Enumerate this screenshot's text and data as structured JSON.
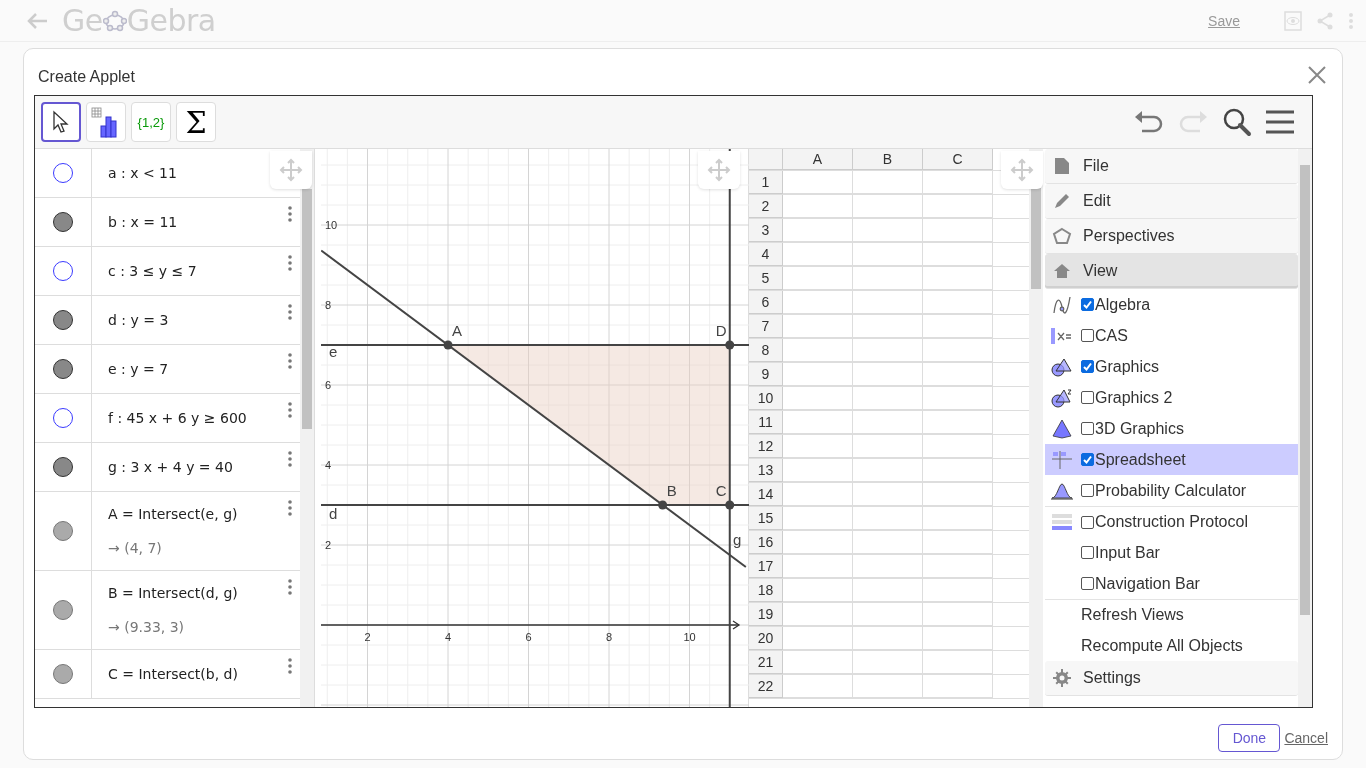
{
  "header": {
    "logo_start": "Ge",
    "logo_end": "Gebra",
    "save": "Save"
  },
  "dialog": {
    "title": "Create Applet",
    "done": "Done",
    "cancel": "Cancel"
  },
  "toolbar": {
    "tools": [
      {
        "kind": "pointer",
        "selected": true
      },
      {
        "kind": "chart",
        "selected": false
      },
      {
        "kind": "text",
        "label": "{1,2}",
        "selected": false
      },
      {
        "kind": "text",
        "label": "Σ",
        "selected": false
      }
    ]
  },
  "algebra": {
    "rows": [
      {
        "kind": "region",
        "definition": "a : x < 11"
      },
      {
        "kind": "line",
        "definition": "b : x = 11"
      },
      {
        "kind": "region",
        "definition": "c : 3 ≤ y ≤ 7"
      },
      {
        "kind": "line",
        "definition": "d : y = 3"
      },
      {
        "kind": "line",
        "definition": "e : y = 7"
      },
      {
        "kind": "region",
        "definition": "f : 45 x + 6 y ≥ 600"
      },
      {
        "kind": "line",
        "definition": "g : 3 x + 4 y = 40"
      },
      {
        "kind": "point",
        "definition": "A = Intersect(e, g)",
        "output": "→  (4, 7)"
      },
      {
        "kind": "point",
        "definition": "B = Intersect(d, g)",
        "output": "→  (9.33, 3)"
      },
      {
        "kind": "point",
        "definition": "C = Intersect(b, d)"
      }
    ]
  },
  "graphics": {
    "x_ticks": [
      "2",
      "4",
      "6",
      "8",
      "10"
    ],
    "y_ticks": [
      "10",
      "8",
      "6",
      "4",
      "2"
    ],
    "point_labels": [
      "A",
      "D",
      "B",
      "C"
    ],
    "line_labels": [
      "e",
      "d",
      "g"
    ]
  },
  "spreadsheet": {
    "columns": [
      "A",
      "B",
      "C"
    ],
    "rows": [
      "1",
      "2",
      "3",
      "4",
      "5",
      "6",
      "7",
      "8",
      "9",
      "10",
      "11",
      "12",
      "13",
      "14",
      "15",
      "16",
      "17",
      "18",
      "19",
      "20",
      "21",
      "22"
    ]
  },
  "menu": {
    "items": [
      {
        "kind": "section",
        "label": "File"
      },
      {
        "kind": "section",
        "label": "Edit"
      },
      {
        "kind": "section",
        "label": "Perspectives"
      },
      {
        "kind": "section",
        "label": "View",
        "expanded": true
      },
      {
        "kind": "view",
        "label": "Algebra",
        "checked": true,
        "selected": false
      },
      {
        "kind": "view",
        "label": "CAS",
        "checked": false,
        "selected": false
      },
      {
        "kind": "view",
        "label": "Graphics",
        "checked": true,
        "selected": false
      },
      {
        "kind": "view",
        "label": "Graphics 2",
        "checked": false,
        "selected": false
      },
      {
        "kind": "view",
        "label": "3D Graphics",
        "checked": false,
        "selected": false
      },
      {
        "kind": "view",
        "label": "Spreadsheet",
        "checked": true,
        "selected": true
      },
      {
        "kind": "view",
        "label": "Probability Calculator",
        "checked": false,
        "selected": false
      },
      {
        "kind": "view",
        "label": "Construction Protocol",
        "checked": false,
        "selected": false
      },
      {
        "kind": "view",
        "label": "Input Bar",
        "checked": false,
        "selected": false
      },
      {
        "kind": "view",
        "label": "Navigation Bar",
        "checked": false,
        "selected": false
      },
      {
        "kind": "action",
        "label": "Refresh Views"
      },
      {
        "kind": "action",
        "label": "Recompute All Objects"
      },
      {
        "kind": "section",
        "label": "Settings"
      }
    ]
  }
}
